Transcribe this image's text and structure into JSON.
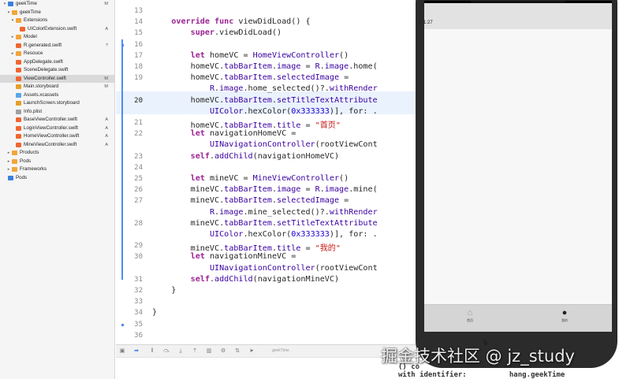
{
  "navigator": {
    "items": [
      {
        "name": "geekTime",
        "badge": "M",
        "depth": 0,
        "kind": "project",
        "disclosure": "▾"
      },
      {
        "name": "geekTime",
        "badge": "",
        "depth": 1,
        "kind": "folder",
        "disclosure": "▾"
      },
      {
        "name": "Extensions",
        "badge": "",
        "depth": 2,
        "kind": "folder",
        "disclosure": "▾"
      },
      {
        "name": "UIColorExtension.swift",
        "badge": "A",
        "depth": 3,
        "kind": "swift",
        "disclosure": ""
      },
      {
        "name": "Model",
        "badge": "",
        "depth": 2,
        "kind": "folder",
        "disclosure": "▸"
      },
      {
        "name": "R.generated.swift",
        "badge": "?",
        "depth": 2,
        "kind": "swift",
        "disclosure": ""
      },
      {
        "name": "Resouce",
        "badge": "",
        "depth": 2,
        "kind": "folder",
        "disclosure": "▸"
      },
      {
        "name": "AppDelegate.swift",
        "badge": "",
        "depth": 2,
        "kind": "swift",
        "disclosure": ""
      },
      {
        "name": "SceneDelegate.swift",
        "badge": "",
        "depth": 2,
        "kind": "swift",
        "disclosure": ""
      },
      {
        "name": "ViewController.swift",
        "badge": "M",
        "depth": 2,
        "kind": "swift",
        "disclosure": "",
        "selected": true
      },
      {
        "name": "Main.storyboard",
        "badge": "M",
        "depth": 2,
        "kind": "storyboard",
        "disclosure": ""
      },
      {
        "name": "Assets.xcassets",
        "badge": "",
        "depth": 2,
        "kind": "assets",
        "disclosure": ""
      },
      {
        "name": "LaunchScreen.storyboard",
        "badge": "",
        "depth": 2,
        "kind": "storyboard",
        "disclosure": ""
      },
      {
        "name": "Info.plist",
        "badge": "",
        "depth": 2,
        "kind": "plist",
        "disclosure": ""
      },
      {
        "name": "BaseViewController.swift",
        "badge": "A",
        "depth": 2,
        "kind": "swift",
        "disclosure": ""
      },
      {
        "name": "LoginViewController.swift",
        "badge": "A",
        "depth": 2,
        "kind": "swift",
        "disclosure": ""
      },
      {
        "name": "HomeViewController.swift",
        "badge": "A",
        "depth": 2,
        "kind": "swift",
        "disclosure": ""
      },
      {
        "name": "MineViewController.swift",
        "badge": "A",
        "depth": 2,
        "kind": "swift",
        "disclosure": ""
      },
      {
        "name": "Products",
        "badge": "",
        "depth": 1,
        "kind": "folder",
        "disclosure": "▸"
      },
      {
        "name": "Pods",
        "badge": "",
        "depth": 1,
        "kind": "folder",
        "disclosure": "▸"
      },
      {
        "name": "Frameworks",
        "badge": "",
        "depth": 1,
        "kind": "folder",
        "disclosure": "▸"
      },
      {
        "name": "Pods",
        "badge": "",
        "depth": 0,
        "kind": "project",
        "disclosure": ""
      }
    ]
  },
  "editor": {
    "current_line": "20",
    "lines": [
      {
        "no": "13",
        "tokens": []
      },
      {
        "no": "14",
        "tokens": [
          [
            "kw",
            "    override func "
          ],
          [
            "plain",
            "viewDidLoad() {"
          ]
        ]
      },
      {
        "no": "15",
        "tokens": [
          [
            "kw",
            "        super"
          ],
          [
            "plain",
            ".viewDidLoad()"
          ]
        ]
      },
      {
        "no": "16",
        "tokens": []
      },
      {
        "no": "17",
        "tokens": [
          [
            "kw",
            "        let "
          ],
          [
            "plain",
            "homeVC = "
          ],
          [
            "type",
            "HomeViewController"
          ],
          [
            "plain",
            "()"
          ]
        ]
      },
      {
        "no": "18",
        "tokens": [
          [
            "plain",
            "        homeVC."
          ],
          [
            "type",
            "tabBarItem"
          ],
          [
            "plain",
            "."
          ],
          [
            "type",
            "image"
          ],
          [
            "plain",
            " = "
          ],
          [
            "type",
            "R"
          ],
          [
            "plain",
            "."
          ],
          [
            "type",
            "image"
          ],
          [
            "plain",
            ".home("
          ]
        ]
      },
      {
        "no": "19",
        "tokens": [
          [
            "plain",
            "        homeVC."
          ],
          [
            "type",
            "tabBarItem"
          ],
          [
            "plain",
            "."
          ],
          [
            "type",
            "selectedImage"
          ],
          [
            "plain",
            " ="
          ]
        ]
      },
      {
        "no": "",
        "tokens": [
          [
            "plain",
            "            "
          ],
          [
            "type",
            "R"
          ],
          [
            "plain",
            "."
          ],
          [
            "type",
            "image"
          ],
          [
            "plain",
            ".home_selected()?."
          ],
          [
            "type",
            "withRender"
          ]
        ]
      },
      {
        "no": "20",
        "tokens": [
          [
            "plain",
            "        homeVC."
          ],
          [
            "type",
            "tabBarItem"
          ],
          [
            "plain",
            "."
          ],
          [
            "type",
            "setTitleTextAttribute"
          ]
        ]
      },
      {
        "no": "",
        "tokens": [
          [
            "plain",
            "            "
          ],
          [
            "type",
            "UIColor"
          ],
          [
            "plain",
            ".hexColor("
          ],
          [
            "num",
            "0x333333"
          ],
          [
            "plain",
            ")], for: ."
          ]
        ]
      },
      {
        "no": "21",
        "tokens": [
          [
            "plain",
            "        homeVC."
          ],
          [
            "type",
            "tabBarItem"
          ],
          [
            "plain",
            "."
          ],
          [
            "type",
            "title"
          ],
          [
            "plain",
            " = "
          ],
          [
            "str",
            "\"首页\""
          ]
        ]
      },
      {
        "no": "22",
        "tokens": [
          [
            "kw",
            "        let "
          ],
          [
            "plain",
            "navigationHomeVC ="
          ]
        ]
      },
      {
        "no": "",
        "tokens": [
          [
            "plain",
            "            "
          ],
          [
            "type",
            "UINavigationController"
          ],
          [
            "plain",
            "(rootViewCont"
          ]
        ]
      },
      {
        "no": "23",
        "tokens": [
          [
            "kw",
            "        self"
          ],
          [
            "plain",
            "."
          ],
          [
            "type",
            "addChild"
          ],
          [
            "plain",
            "(navigationHomeVC)"
          ]
        ]
      },
      {
        "no": "24",
        "tokens": []
      },
      {
        "no": "25",
        "tokens": [
          [
            "kw",
            "        let "
          ],
          [
            "plain",
            "mineVC = "
          ],
          [
            "type",
            "MineViewController"
          ],
          [
            "plain",
            "()"
          ]
        ]
      },
      {
        "no": "26",
        "tokens": [
          [
            "plain",
            "        mineVC."
          ],
          [
            "type",
            "tabBarItem"
          ],
          [
            "plain",
            "."
          ],
          [
            "type",
            "image"
          ],
          [
            "plain",
            " = "
          ],
          [
            "type",
            "R"
          ],
          [
            "plain",
            "."
          ],
          [
            "type",
            "image"
          ],
          [
            "plain",
            ".mine("
          ]
        ]
      },
      {
        "no": "27",
        "tokens": [
          [
            "plain",
            "        mineVC."
          ],
          [
            "type",
            "tabBarItem"
          ],
          [
            "plain",
            "."
          ],
          [
            "type",
            "selectedImage"
          ],
          [
            "plain",
            " ="
          ]
        ]
      },
      {
        "no": "",
        "tokens": [
          [
            "plain",
            "            "
          ],
          [
            "type",
            "R"
          ],
          [
            "plain",
            "."
          ],
          [
            "type",
            "image"
          ],
          [
            "plain",
            ".mine_selected()?."
          ],
          [
            "type",
            "withRender"
          ]
        ]
      },
      {
        "no": "28",
        "tokens": [
          [
            "plain",
            "        mineVC."
          ],
          [
            "type",
            "tabBarItem"
          ],
          [
            "plain",
            "."
          ],
          [
            "type",
            "setTitleTextAttribute"
          ]
        ]
      },
      {
        "no": "",
        "tokens": [
          [
            "plain",
            "            "
          ],
          [
            "type",
            "UIColor"
          ],
          [
            "plain",
            ".hexColor("
          ],
          [
            "num",
            "0x333333"
          ],
          [
            "plain",
            ")], for: ."
          ]
        ]
      },
      {
        "no": "29",
        "tokens": [
          [
            "plain",
            "        mineVC."
          ],
          [
            "type",
            "tabBarItem"
          ],
          [
            "plain",
            "."
          ],
          [
            "type",
            "title"
          ],
          [
            "plain",
            " = "
          ],
          [
            "str",
            "\"我的\""
          ]
        ]
      },
      {
        "no": "30",
        "tokens": [
          [
            "kw",
            "        let "
          ],
          [
            "plain",
            "navigationMineVC ="
          ]
        ]
      },
      {
        "no": "",
        "tokens": [
          [
            "plain",
            "            "
          ],
          [
            "type",
            "UINavigationController"
          ],
          [
            "plain",
            "(rootViewCont"
          ]
        ]
      },
      {
        "no": "31",
        "tokens": [
          [
            "kw",
            "        self"
          ],
          [
            "plain",
            "."
          ],
          [
            "type",
            "addChild"
          ],
          [
            "plain",
            "(navigationMineVC)"
          ]
        ]
      },
      {
        "no": "32",
        "tokens": [
          [
            "plain",
            "    }"
          ]
        ]
      },
      {
        "no": "33",
        "tokens": []
      },
      {
        "no": "34",
        "tokens": [
          [
            "plain",
            "}"
          ]
        ]
      },
      {
        "no": "35",
        "tokens": []
      },
      {
        "no": "36",
        "tokens": []
      }
    ]
  },
  "debug_bar": {
    "target": "geekTime",
    "icons": [
      "debug-area-toggle-icon",
      "breakpoint-toggle-icon",
      "pause-icon",
      "step-over-icon",
      "step-into-icon",
      "step-out-icon",
      "view-hierarchy-icon",
      "memory-graph-icon",
      "environment-icon",
      "location-icon"
    ]
  },
  "simulator": {
    "status_time": "1:27",
    "tabs": [
      {
        "icon": "⌂",
        "label": "首页",
        "icon_name": "home-tab-icon"
      },
      {
        "icon": "●",
        "label": "我的",
        "icon_name": "mine-tab-icon"
      }
    ]
  },
  "console_peek": {
    "line1": "() co",
    "line2": "with identifier:",
    "line2_tail": "hang.geekTime"
  },
  "watermark": "掘金技术社区 @ jz_study",
  "colors": {
    "keyword": "#9b2393",
    "type": "#3900a0",
    "number": "#1c00cf",
    "string": "#c41a16",
    "change_bar": "#4b8df0",
    "selection": "#d9d9d9"
  }
}
